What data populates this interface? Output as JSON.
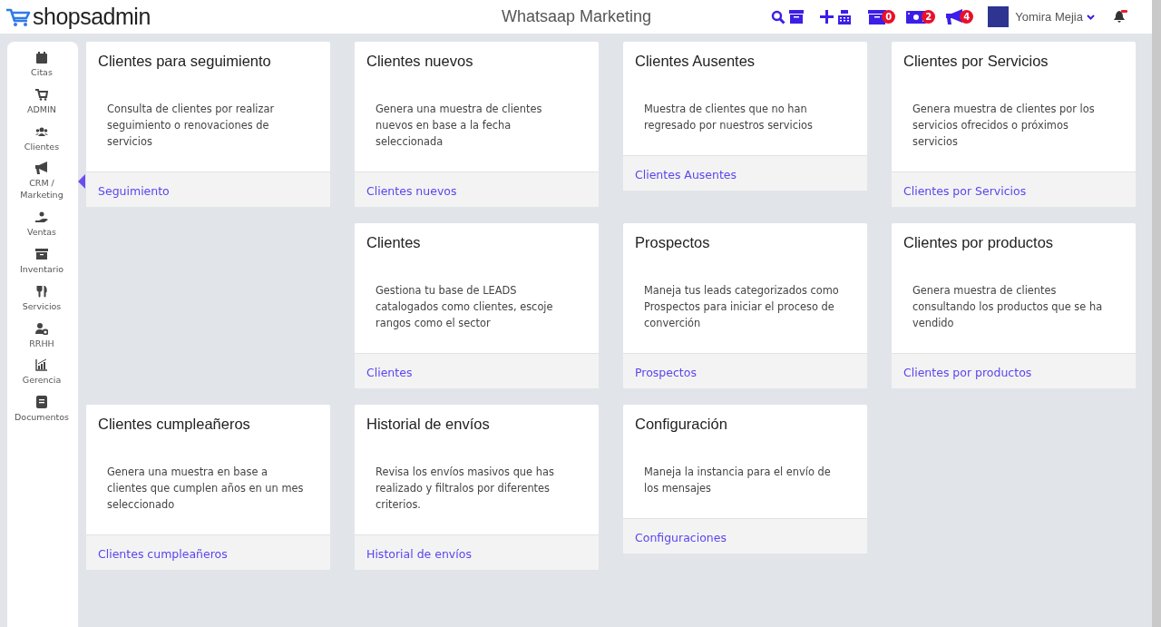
{
  "header": {
    "logo": "shopsadmin",
    "title": "Whatsaap Marketing",
    "badges": [
      {
        "kind": "box",
        "count": "0"
      },
      {
        "kind": "money",
        "count": "2"
      },
      {
        "kind": "megaphone",
        "count": "4"
      }
    ],
    "user": {
      "name": "Yomira Mejia"
    }
  },
  "sidebar": {
    "items": [
      {
        "label": "Citas",
        "selected": false
      },
      {
        "label": "ADMIN",
        "selected": false
      },
      {
        "label": "Clientes",
        "selected": false
      },
      {
        "label": "CRM / Marketing",
        "selected": true
      },
      {
        "label": "Ventas",
        "selected": false
      },
      {
        "label": "Inventario",
        "selected": false
      },
      {
        "label": "Servicios",
        "selected": false
      },
      {
        "label": "RRHH",
        "selected": false
      },
      {
        "label": "Gerencia",
        "selected": false
      },
      {
        "label": "Documentos",
        "selected": false
      }
    ]
  },
  "cards": [
    {
      "title": "Clientes para seguimiento",
      "description": "Consulta de clientes por realizar seguimiento o renovaciones de servicios",
      "link": "Seguimiento"
    },
    {
      "title": "Clientes nuevos",
      "description": "Genera una muestra de clientes nuevos en base a la fecha seleccionada",
      "link": "Clientes nuevos"
    },
    {
      "title": "Clientes Ausentes",
      "description": "Muestra de clientes que no han regresado por nuestros servicios",
      "link": "Clientes Ausentes"
    },
    {
      "title": "Clientes por Servicios",
      "description": "Genera muestra de clientes por los servicios ofrecidos o próximos servicios",
      "link": "Clientes por Servicios"
    },
    {
      "title": "Clientes",
      "description": "Gestiona tu base de LEADS catalogados como clientes, escoje rangos como el sector",
      "link": "Clientes"
    },
    {
      "title": "Prospectos",
      "description": "Maneja tus leads categorizados como Prospectos para iniciar el proceso de converción",
      "link": "Prospectos"
    },
    {
      "title": "Clientes por productos",
      "description": "Genera muestra de clientes consultando los productos que se ha vendido",
      "link": "Clientes por productos"
    },
    {
      "title": "Clientes cumpleañeros",
      "description": "Genera una muestra en base a clientes que cumplen años en un mes seleccionado",
      "link": "Clientes cumpleañeros"
    },
    {
      "title": "Historial de envíos",
      "description": "Revisa los envíos masivos que has realizado y filtralos por diferentes criterios.",
      "link": "Historial de envíos"
    },
    {
      "title": "Configuración",
      "description": "Maneja la instancia para el envío de los mensajes",
      "link": "Configuraciones"
    }
  ]
}
